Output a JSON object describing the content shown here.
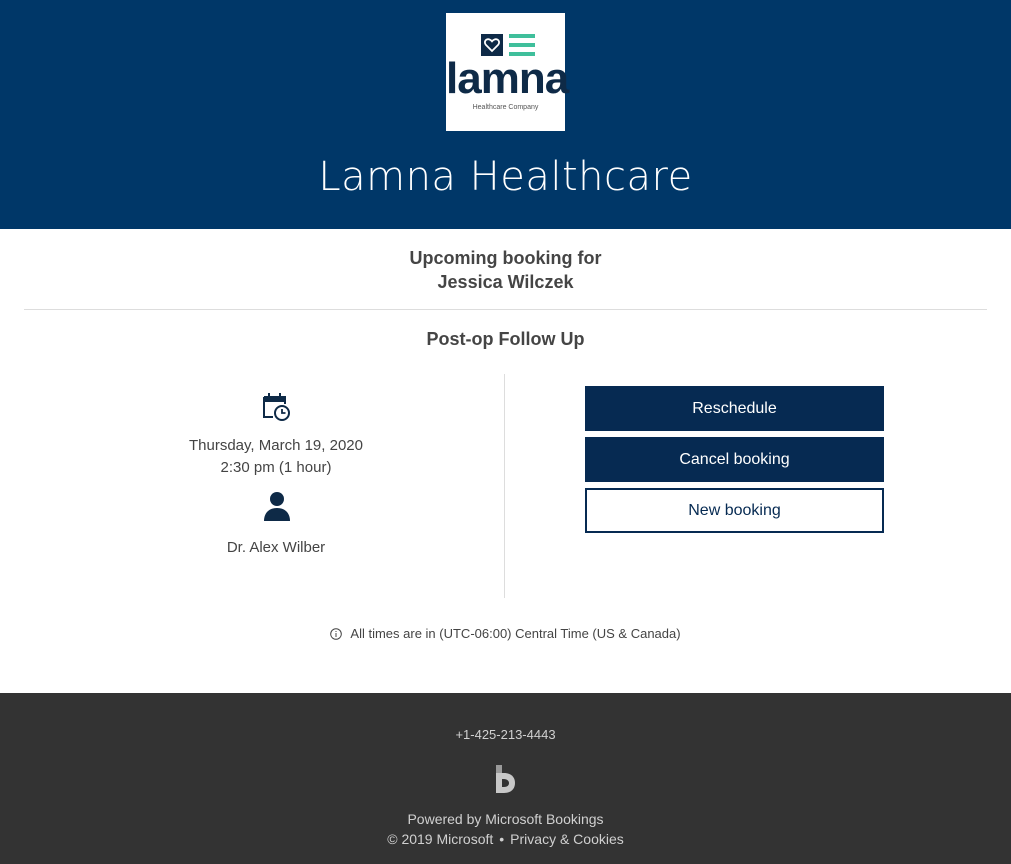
{
  "header": {
    "logo_word": "lamna",
    "logo_tagline": "Healthcare Company",
    "company_name": "Lamna Healthcare",
    "brand_color": "#003768",
    "logo_accent": "#3fbf9b"
  },
  "booking": {
    "heading_line1": "Upcoming booking for",
    "heading_line2": "Jessica Wilczek",
    "service": "Post-op Follow Up",
    "date": "Thursday, March 19, 2020",
    "time": "2:30 pm (1 hour)",
    "staff": "Dr. Alex Wilber",
    "icons": [
      "calendar-clock-icon",
      "person-icon"
    ]
  },
  "actions": {
    "reschedule": "Reschedule",
    "cancel": "Cancel booking",
    "new": "New booking",
    "button_color": "#062a52"
  },
  "timezone_note": "All times are in (UTC-06:00) Central Time (US & Canada)",
  "footer": {
    "phone": "+1-425-213-4443",
    "powered_by": "Powered by Microsoft Bookings",
    "copyright": "© 2019 Microsoft",
    "separator": "•",
    "privacy_link": "Privacy & Cookies",
    "background": "#333333"
  }
}
